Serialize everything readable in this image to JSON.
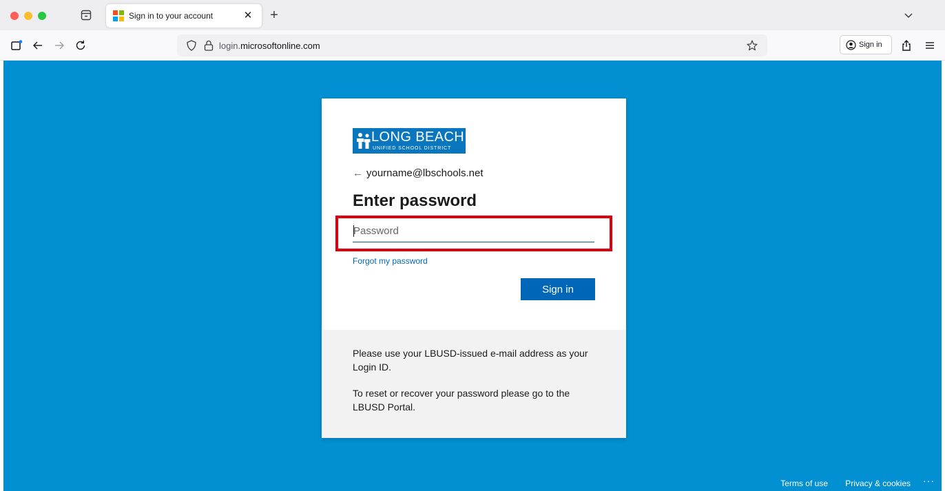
{
  "browser": {
    "tab": {
      "title": "Sign in to your account"
    },
    "new_tab_label": "+",
    "url": {
      "prefix": "login.",
      "domain": "microsoftonline.com"
    },
    "signin_label": "Sign in"
  },
  "card": {
    "logo": {
      "line1": "LONG BEACH",
      "line2": "UNIFIED SCHOOL DISTRICT"
    },
    "back_arrow": "←",
    "identity": "yourname@lbschools.net",
    "heading": "Enter password",
    "password_placeholder": "Password",
    "forgot_link": "Forgot my password",
    "signin_button": "Sign in",
    "info": {
      "line1": "Please use your LBUSD-issued e-mail address as your Login ID.",
      "line2": "To reset or recover your password please go to the LBUSD Portal."
    }
  },
  "footer": {
    "terms": "Terms of use",
    "privacy": "Privacy & cookies",
    "more": "···"
  },
  "colors": {
    "page_background": "#0290d2",
    "button_primary": "#0067b8",
    "link": "#0067b8",
    "highlight_border": "#e0000b",
    "logo_background": "#0a76bd"
  },
  "icons": {
    "tab_favicon": "microsoft-logo-icon",
    "back": "arrow-left-icon",
    "forward": "arrow-right-icon",
    "reload": "reload-icon",
    "tracking": "shield-icon",
    "security": "lock-icon",
    "bookmark": "star-icon",
    "account": "account-icon",
    "share": "share-icon",
    "menu": "hamburger-menu-icon"
  }
}
